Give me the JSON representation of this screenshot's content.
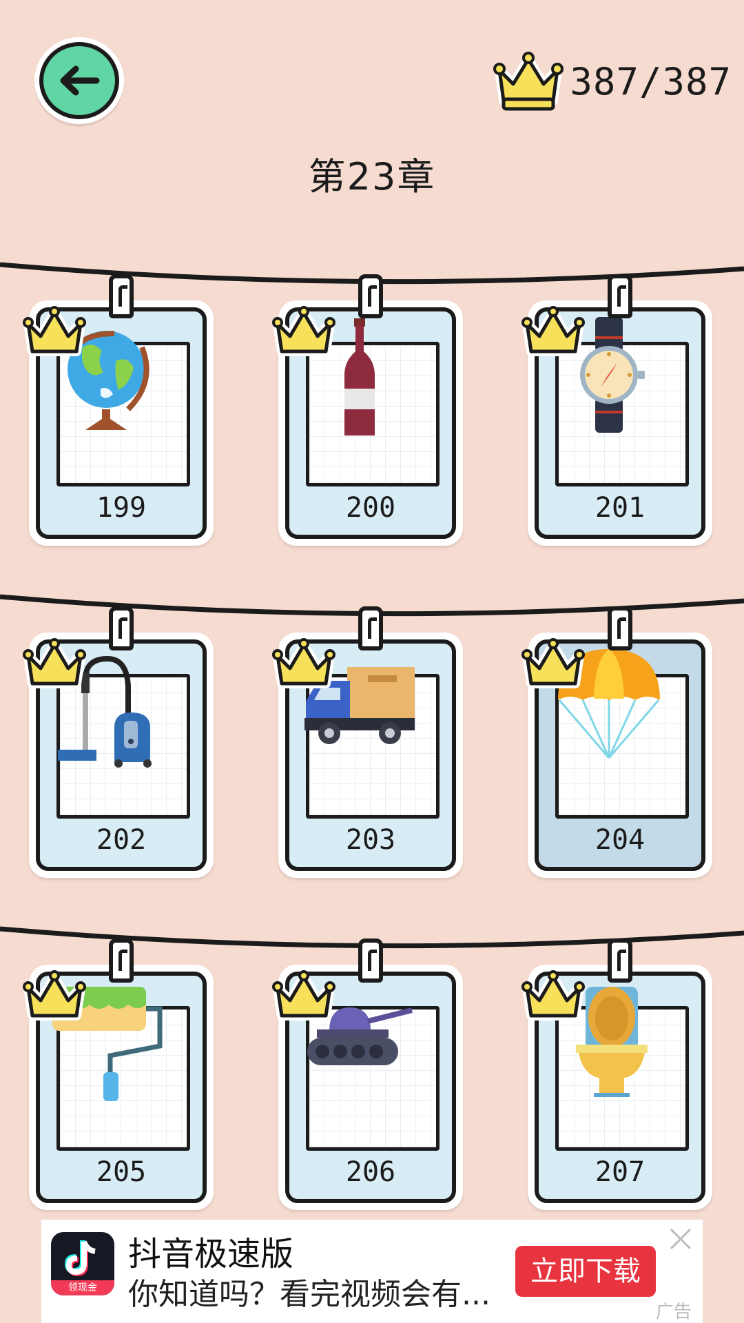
{
  "header": {
    "back_icon": "arrow-left-icon",
    "crown_icon": "crown-icon",
    "crown_count": "387/387",
    "chapter_title": "第23章"
  },
  "levels": [
    {
      "number": "199",
      "item": "globe",
      "completed": true
    },
    {
      "number": "200",
      "item": "wine-bottle",
      "completed": true
    },
    {
      "number": "201",
      "item": "wristwatch",
      "completed": true
    },
    {
      "number": "202",
      "item": "vacuum-cleaner",
      "completed": true
    },
    {
      "number": "203",
      "item": "delivery-truck",
      "completed": true
    },
    {
      "number": "204",
      "item": "parachute",
      "completed": true
    },
    {
      "number": "205",
      "item": "paint-roller",
      "completed": true
    },
    {
      "number": "206",
      "item": "tank",
      "completed": true
    },
    {
      "number": "207",
      "item": "toilet",
      "completed": true
    }
  ],
  "ad": {
    "app_name": "抖音极速版",
    "badge": "领现金",
    "description": "你知道吗？看完视频会有...",
    "cta": "立即下载",
    "tag": "广告"
  },
  "colors": {
    "background": "#f6dbd0",
    "back_button": "#5fd6a4",
    "crown": "#f7e15a",
    "card_panel": "#d8ecf6",
    "ad_cta": "#e8343f"
  }
}
